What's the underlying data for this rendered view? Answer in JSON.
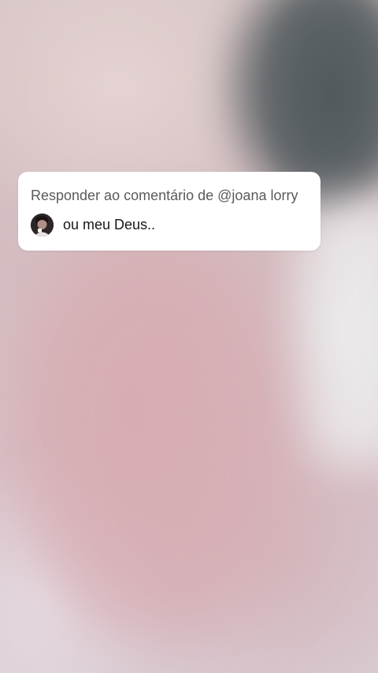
{
  "reply_sticker": {
    "title": "Responder ao comentário de @joana lorry",
    "comment_text": "ou meu Deus..",
    "avatar_icon": "user-avatar-photo"
  },
  "colors": {
    "card_background": "#ffffff",
    "title_text": "#5a5a5a",
    "comment_text": "#161616"
  }
}
